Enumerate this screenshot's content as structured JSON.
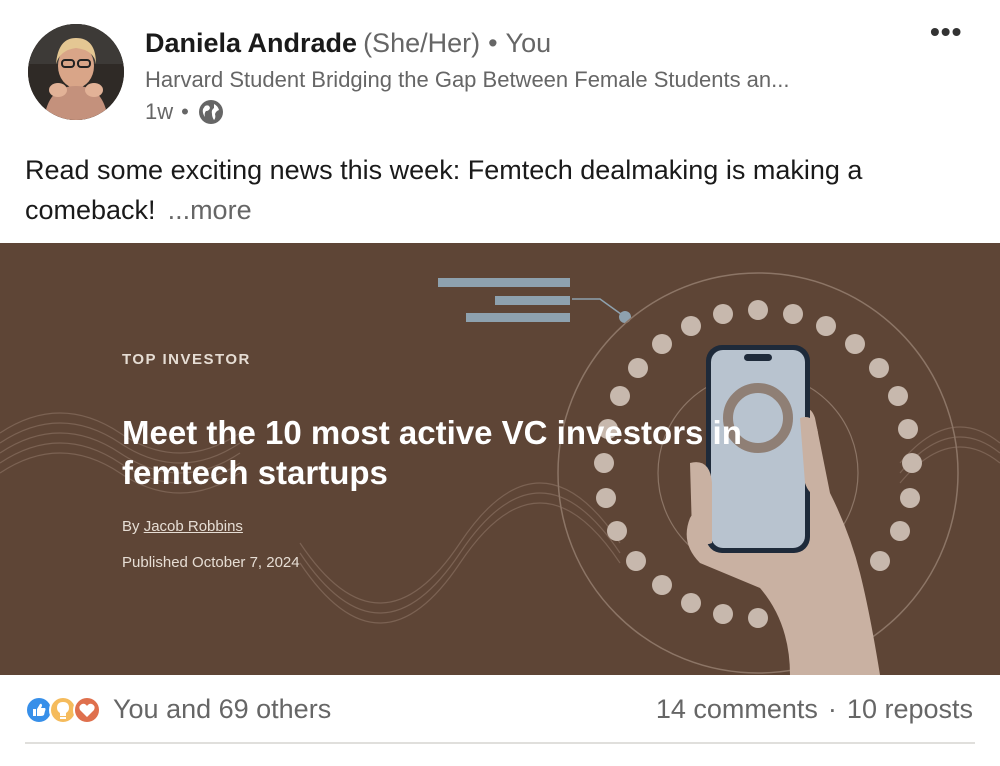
{
  "author": {
    "name": "Daniela Andrade",
    "pronouns": "(She/Her)",
    "relation": "You",
    "headline": "Harvard Student Bridging the Gap Between Female Students an...",
    "time": "1w",
    "visibility_icon": "globe-icon"
  },
  "menu": {
    "icon": "more-options-icon",
    "label": "•••"
  },
  "post": {
    "text": "Read some exciting news this week: Femtech dealmaking is making a comeback!",
    "see_more": "...more"
  },
  "article_image": {
    "eyebrow": "TOP INVESTOR",
    "title": "Meet the 10 most active VC investors in femtech startups",
    "by_prefix": "By",
    "author": "Jacob Robbins",
    "published": "Published October 7, 2024",
    "background_color": "#5e4536"
  },
  "social": {
    "reaction_icons": [
      "like-icon",
      "insightful-icon",
      "love-icon"
    ],
    "reactions_text": "You and 69 others",
    "comments": "14 comments",
    "separator": "·",
    "reposts": "10 reposts"
  },
  "colors": {
    "like": "#378fe9",
    "insightful": "#f5bb5c",
    "love": "#df704d"
  }
}
